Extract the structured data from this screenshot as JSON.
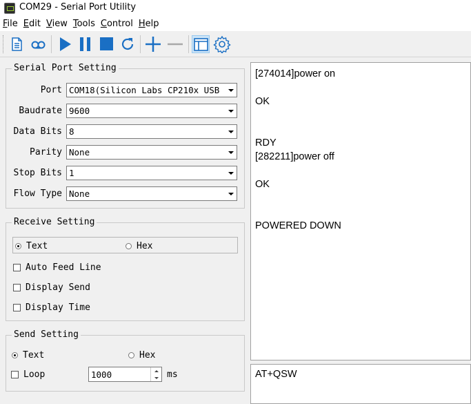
{
  "window": {
    "title": "COM29 - Serial Port Utility"
  },
  "menu": [
    "File",
    "Edit",
    "View",
    "Tools",
    "Control",
    "Help"
  ],
  "toolbar": {
    "icons": [
      "new-document-icon",
      "loop-icon",
      "play-icon",
      "pause-icon",
      "stop-icon",
      "refresh-icon",
      "add-icon",
      "remove-icon",
      "window-icon",
      "settings-icon"
    ],
    "colors": {
      "accent": "#1a6fc4"
    }
  },
  "serial_port": {
    "title": "Serial Port Setting",
    "fields": [
      {
        "label": "Port",
        "value": "COM18(Silicon Labs CP210x USB"
      },
      {
        "label": "Baudrate",
        "value": "9600"
      },
      {
        "label": "Data Bits",
        "value": "8"
      },
      {
        "label": "Parity",
        "value": "None"
      },
      {
        "label": "Stop Bits",
        "value": "1"
      },
      {
        "label": "Flow Type",
        "value": "None"
      }
    ]
  },
  "receive_setting": {
    "title": "Receive Setting",
    "mode_text": "Text",
    "mode_hex": "Hex",
    "selected": "Text",
    "options": [
      {
        "label": "Auto Feed Line",
        "checked": false
      },
      {
        "label": "Display Send",
        "checked": false
      },
      {
        "label": "Display Time",
        "checked": false
      }
    ]
  },
  "send_setting": {
    "title": "Send Setting",
    "mode_text": "Text",
    "mode_hex": "Hex",
    "selected": "Text",
    "loop_label": "Loop",
    "loop_checked": false,
    "interval": "1000",
    "unit": "ms"
  },
  "receive_log": [
    "[274014]power on",
    "",
    "OK",
    "",
    "",
    "RDY",
    "[282211]power off",
    "",
    "OK",
    "",
    "",
    "POWERED DOWN"
  ],
  "send_input": "AT+QSW"
}
